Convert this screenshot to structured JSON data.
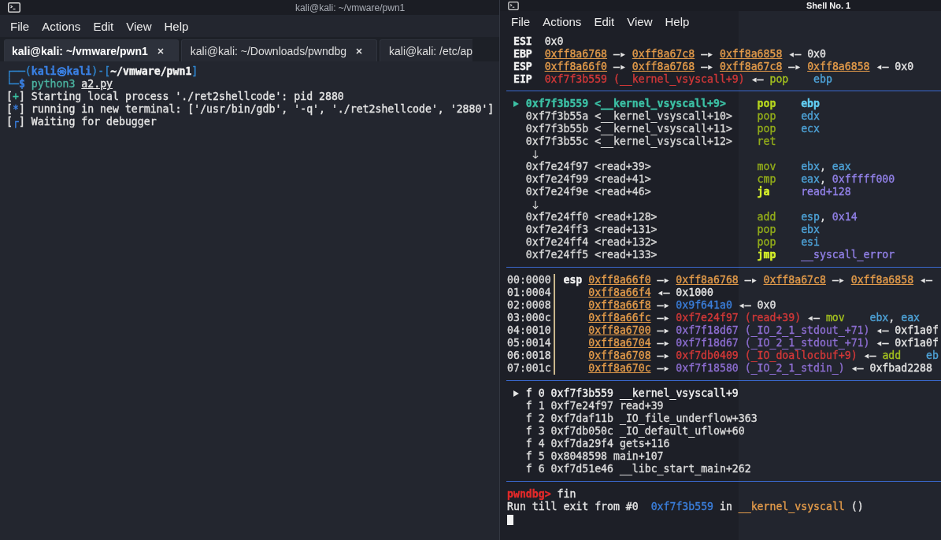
{
  "left_window": {
    "title": "kali@kali: ~/vmware/pwn1",
    "menu": [
      "File",
      "Actions",
      "Edit",
      "View",
      "Help"
    ],
    "tabs": [
      {
        "label": "kali@kali: ~/vmware/pwn1",
        "selected": true,
        "closable": true
      },
      {
        "label": "kali@kali: ~/Downloads/pwndbg",
        "selected": false,
        "closable": true
      },
      {
        "label": "kali@kali: /etc/ap",
        "selected": false,
        "closable": false
      }
    ],
    "terminal_lines": [
      [
        {
          "kind": "frame",
          "text": "┌──("
        },
        {
          "kind": "user",
          "text": "kali㉿kali"
        },
        {
          "kind": "frame",
          "text": ")-["
        },
        {
          "kind": "path",
          "text": "~/vmware/pwn1"
        },
        {
          "kind": "frame",
          "text": "]"
        }
      ],
      [
        {
          "kind": "frame",
          "text": "└─"
        },
        {
          "kind": "user",
          "text": "$ "
        },
        {
          "kind": "cmd",
          "text": "python3 "
        },
        {
          "kind": "file",
          "text": "a2.py"
        }
      ],
      [
        {
          "kind": "plain",
          "text": "["
        },
        {
          "kind": "ok",
          "text": "+"
        },
        {
          "kind": "plain",
          "text": "] Starting local process './ret2shellcode': pid 2880"
        }
      ],
      [
        {
          "kind": "plain",
          "text": "["
        },
        {
          "kind": "info",
          "text": "*"
        },
        {
          "kind": "plain",
          "text": "] running in new terminal: ['/usr/bin/gdb', '-q', './ret2shellcode', '2880']"
        }
      ],
      [
        {
          "kind": "plain",
          "text": "["
        },
        {
          "kind": "info",
          "text": "┌"
        },
        {
          "kind": "plain",
          "text": "] Waiting for debugger"
        }
      ]
    ]
  },
  "right_window": {
    "title": "Shell No. 1",
    "menu": [
      "File",
      "Actions",
      "Edit",
      "View",
      "Help"
    ],
    "registers": [
      {
        "name": "ESI",
        "value": [
          {
            "kind": "plain",
            "text": "0x0"
          }
        ]
      },
      {
        "name": "EBP",
        "value": [
          {
            "kind": "stack",
            "text": "0xff8a6768"
          },
          {
            "kind": "plain",
            "text": " —▸ "
          },
          {
            "kind": "stack",
            "text": "0xff8a67c8"
          },
          {
            "kind": "plain",
            "text": " —▸ "
          },
          {
            "kind": "stack",
            "text": "0xff8a6858"
          },
          {
            "kind": "plain",
            "text": " ◂— 0x0"
          }
        ]
      },
      {
        "name": "ESP",
        "value": [
          {
            "kind": "stack",
            "text": "0xff8a66f0"
          },
          {
            "kind": "plain",
            "text": " —▸ "
          },
          {
            "kind": "stack",
            "text": "0xff8a6768"
          },
          {
            "kind": "plain",
            "text": " —▸ "
          },
          {
            "kind": "stack",
            "text": "0xff8a67c8"
          },
          {
            "kind": "plain",
            "text": " —▸ "
          },
          {
            "kind": "stack",
            "text": "0xff8a6858"
          },
          {
            "kind": "plain",
            "text": " ◂— 0x0"
          }
        ]
      },
      {
        "name": "EIP",
        "value": [
          {
            "kind": "code",
            "text": "0xf7f3b559 (__kernel_vsyscall+9)"
          },
          {
            "kind": "plain",
            "text": " ◂— "
          },
          {
            "kind": "mnemonic",
            "text": "pop"
          },
          {
            "kind": "operand",
            "text": "ebp"
          }
        ]
      }
    ],
    "disassembly": [
      {
        "kind": "instruction",
        "current": true,
        "jump": false,
        "address": "0xf7f3b559",
        "symbol": "<__kernel_vsyscall+9>",
        "mnemonic": "pop",
        "operands": [
          {
            "kind": "operand",
            "text": "ebp"
          }
        ]
      },
      {
        "kind": "instruction",
        "current": false,
        "jump": false,
        "address": "0xf7f3b55a",
        "symbol": "<__kernel_vsyscall+10>",
        "mnemonic": "pop",
        "operands": [
          {
            "kind": "operand",
            "text": "edx"
          }
        ]
      },
      {
        "kind": "instruction",
        "current": false,
        "jump": false,
        "address": "0xf7f3b55b",
        "symbol": "<__kernel_vsyscall+11>",
        "mnemonic": "pop",
        "operands": [
          {
            "kind": "operand",
            "text": "ecx"
          }
        ]
      },
      {
        "kind": "instruction",
        "current": false,
        "jump": false,
        "address": "0xf7f3b55c",
        "symbol": "<__kernel_vsyscall+12>",
        "mnemonic": "ret"
      },
      {
        "kind": "branch-arrow"
      },
      {
        "kind": "instruction",
        "current": false,
        "jump": false,
        "address": "0xf7e24f97",
        "symbol": "<read+39>",
        "mnemonic": "mov",
        "operands": [
          {
            "kind": "operand",
            "text": "ebx"
          },
          {
            "kind": "plain",
            "text": ", "
          },
          {
            "kind": "operand",
            "text": "eax"
          }
        ]
      },
      {
        "kind": "instruction",
        "current": false,
        "jump": false,
        "address": "0xf7e24f99",
        "symbol": "<read+41>",
        "mnemonic": "cmp",
        "operands": [
          {
            "kind": "operand",
            "text": "eax"
          },
          {
            "kind": "plain",
            "text": ", "
          },
          {
            "kind": "imm",
            "text": "0xfffff000"
          }
        ]
      },
      {
        "kind": "instruction",
        "current": false,
        "jump": true,
        "address": "0xf7e24f9e",
        "symbol": "<read+46>",
        "mnemonic": "ja",
        "operands": [
          {
            "kind": "imm",
            "text": "read+128"
          }
        ]
      },
      {
        "kind": "branch-arrow"
      },
      {
        "kind": "instruction",
        "current": false,
        "jump": false,
        "address": "0xf7e24ff0",
        "symbol": "<read+128>",
        "mnemonic": "add",
        "operands": [
          {
            "kind": "operand",
            "text": "esp"
          },
          {
            "kind": "plain",
            "text": ", "
          },
          {
            "kind": "imm",
            "text": "0x14"
          }
        ]
      },
      {
        "kind": "instruction",
        "current": false,
        "jump": false,
        "address": "0xf7e24ff3",
        "symbol": "<read+131>",
        "mnemonic": "pop",
        "operands": [
          {
            "kind": "operand",
            "text": "ebx"
          }
        ]
      },
      {
        "kind": "instruction",
        "current": false,
        "jump": false,
        "address": "0xf7e24ff4",
        "symbol": "<read+132>",
        "mnemonic": "pop",
        "operands": [
          {
            "kind": "operand",
            "text": "esi"
          }
        ]
      },
      {
        "kind": "instruction",
        "current": false,
        "jump": true,
        "address": "0xf7e24ff5",
        "symbol": "<read+133>",
        "mnemonic": "jmp",
        "operands": [
          {
            "kind": "imm",
            "text": "__syscall_error"
          }
        ]
      }
    ],
    "stack": [
      {
        "offset": "00:0000",
        "register": "esp",
        "value": [
          {
            "kind": "stack",
            "text": "0xff8a66f0"
          },
          {
            "kind": "plain",
            "text": " —▸ "
          },
          {
            "kind": "stack",
            "text": "0xff8a6768"
          },
          {
            "kind": "plain",
            "text": " —▸ "
          },
          {
            "kind": "stack",
            "text": "0xff8a67c8"
          },
          {
            "kind": "plain",
            "text": " —▸ "
          },
          {
            "kind": "stack",
            "text": "0xff8a6858"
          },
          {
            "kind": "plain",
            "text": " ◂—"
          }
        ]
      },
      {
        "offset": "01:0004",
        "value": [
          {
            "kind": "stack",
            "text": "0xff8a66f4"
          },
          {
            "kind": "plain",
            "text": " ◂— 0x1000"
          }
        ]
      },
      {
        "offset": "02:0008",
        "value": [
          {
            "kind": "stack",
            "text": "0xff8a66f8"
          },
          {
            "kind": "plain",
            "text": " —▸ "
          },
          {
            "kind": "heap",
            "text": "0x9f641a0"
          },
          {
            "kind": "plain",
            "text": " ◂— 0x0"
          }
        ]
      },
      {
        "offset": "03:000c",
        "value": [
          {
            "kind": "stack",
            "text": "0xff8a66fc"
          },
          {
            "kind": "plain",
            "text": " —▸ "
          },
          {
            "kind": "code",
            "text": "0xf7e24f97 (read+39)"
          },
          {
            "kind": "plain",
            "text": " ◂— "
          },
          {
            "kind": "mnemonic",
            "text": "mov"
          },
          {
            "kind": "operand",
            "text": "ebx"
          },
          {
            "kind": "plain",
            "text": ", "
          },
          {
            "kind": "operand",
            "text": "eax"
          }
        ]
      },
      {
        "offset": "04:0010",
        "value": [
          {
            "kind": "stack",
            "text": "0xff8a6700"
          },
          {
            "kind": "plain",
            "text": " —▸ "
          },
          {
            "kind": "data",
            "text": "0xf7f18d67 (_IO_2_1_stdout_+71)"
          },
          {
            "kind": "plain",
            "text": " ◂— 0xf1a0f"
          }
        ]
      },
      {
        "offset": "05:0014",
        "value": [
          {
            "kind": "stack",
            "text": "0xff8a6704"
          },
          {
            "kind": "plain",
            "text": " —▸ "
          },
          {
            "kind": "data",
            "text": "0xf7f18d67 (_IO_2_1_stdout_+71)"
          },
          {
            "kind": "plain",
            "text": " ◂— 0xf1a0f"
          }
        ]
      },
      {
        "offset": "06:0018",
        "value": [
          {
            "kind": "stack",
            "text": "0xff8a6708"
          },
          {
            "kind": "plain",
            "text": " —▸ "
          },
          {
            "kind": "code",
            "text": "0xf7db0409 (_IO_doallocbuf+9)"
          },
          {
            "kind": "plain",
            "text": " ◂— "
          },
          {
            "kind": "mnemonic",
            "text": "add"
          },
          {
            "kind": "operand",
            "text": "eb"
          }
        ]
      },
      {
        "offset": "07:001c",
        "value": [
          {
            "kind": "stack",
            "text": "0xff8a670c"
          },
          {
            "kind": "plain",
            "text": " —▸ "
          },
          {
            "kind": "data",
            "text": "0xf7f18580 (_IO_2_1_stdin_)"
          },
          {
            "kind": "plain",
            "text": " ◂— 0xfbad2288"
          }
        ]
      }
    ],
    "backtrace": [
      {
        "current": true,
        "frame": "f 0",
        "address": "0xf7f3b559",
        "symbol": "__kernel_vsyscall+9"
      },
      {
        "current": false,
        "frame": "f 1",
        "address": "0xf7e24f97",
        "symbol": "read+39"
      },
      {
        "current": false,
        "frame": "f 2",
        "address": "0xf7daf11b",
        "symbol": "_IO_file_underflow+363"
      },
      {
        "current": false,
        "frame": "f 3",
        "address": "0xf7db050c",
        "symbol": "_IO_default_uflow+60"
      },
      {
        "current": false,
        "frame": "f 4",
        "address": "0xf7da29f4",
        "symbol": "gets+116"
      },
      {
        "current": false,
        "frame": "f 5",
        "address": "0x8048598",
        "symbol": "main+107"
      },
      {
        "current": false,
        "frame": "f 6",
        "address": "0xf7d51e46",
        "symbol": "__libc_start_main+262"
      }
    ],
    "console": [
      [
        {
          "kind": "prompt",
          "text": "pwndbg> "
        },
        {
          "kind": "plain",
          "text": "fin"
        }
      ],
      [
        {
          "kind": "plain",
          "text": "Run till exit from #0  "
        },
        {
          "kind": "heap",
          "text": "0xf7f3b559"
        },
        {
          "kind": "plain",
          "text": " in "
        },
        {
          "kind": "func",
          "text": "__kernel_vsyscall"
        },
        {
          "kind": "plain",
          "text": " ()"
        }
      ]
    ]
  }
}
